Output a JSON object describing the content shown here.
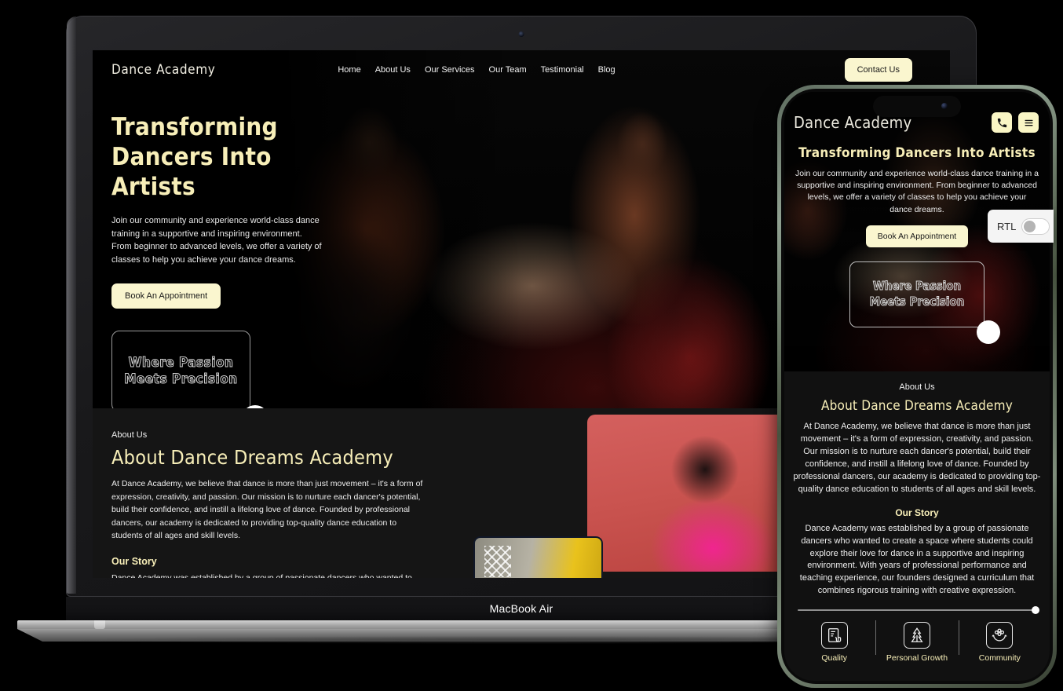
{
  "device_labels": {
    "laptop": "MacBook Air"
  },
  "site": {
    "brand": "Dance Academy",
    "nav": [
      {
        "label": "Home"
      },
      {
        "label": "About Us"
      },
      {
        "label": "Our Services"
      },
      {
        "label": "Our Team"
      },
      {
        "label": "Testimonial"
      },
      {
        "label": "Blog"
      }
    ],
    "contact_button": "Contact Us",
    "hero": {
      "title_line1": "Transforming",
      "title_line2": "Dancers Into Artists",
      "title_full": "Transforming Dancers Into Artists",
      "paragraph": "Join our community and experience world-class dance training in a supportive and inspiring environment. From beginner to advanced levels, we offer a variety of classes to help you achieve your dance dreams.",
      "cta": "Book An Appointment",
      "tagline_line1": "Where Passion",
      "tagline_line2": "Meets Precision"
    },
    "about": {
      "eyebrow": "About Us",
      "heading": "About Dance Dreams Academy",
      "paragraph": "At Dance Academy, we believe that dance is more than just movement – it's a form of expression, creativity, and passion. Our mission is to nurture each dancer's potential, build their confidence, and instill a lifelong love of dance. Founded by professional dancers, our academy is dedicated to providing top-quality dance education to students of all ages and skill levels.",
      "story_heading": "Our Story",
      "story_paragraph": "Dance Academy was established by a group of passionate dancers who wanted to create a space where students could explore their love for dance in a supportive and inspiring environment. With years of professional performance and teaching experience, our founders designed a curriculum that combines rigorous training with creative expression."
    },
    "features": [
      {
        "label": "Quality",
        "icon": "document-hand-icon"
      },
      {
        "label": "Personal Growth",
        "icon": "growth-arrow-icon"
      },
      {
        "label": "Community",
        "icon": "hands-people-icon"
      }
    ],
    "phone_actions": [
      {
        "icon": "phone-icon"
      },
      {
        "icon": "hamburger-menu-icon"
      }
    ]
  },
  "rtl_widget": {
    "label": "RTL",
    "state": "off"
  },
  "colors": {
    "accent_cream": "#faf6cf",
    "heading_yellow": "#f7eeb8",
    "dark_bg": "#111111",
    "hero_bg": "#050505"
  }
}
